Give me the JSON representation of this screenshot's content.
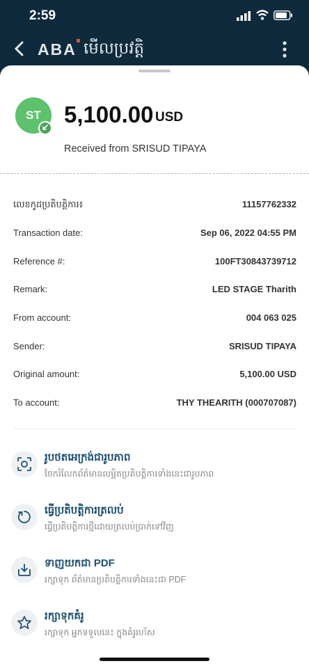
{
  "status_bar": {
    "time": "2:59"
  },
  "app_bar": {
    "brand": "ABA",
    "title": "មើលប្រវត្តិ"
  },
  "transaction": {
    "avatar_initials": "ST",
    "amount": "5,100.00",
    "currency": "USD",
    "received_text": "Received from SRISUD TIPAYA"
  },
  "details": [
    {
      "label": "លេខកូដប្រតិបត្តិការ៖",
      "value": "11157762332"
    },
    {
      "label": "Transaction date:",
      "value": "Sep 06, 2022 04:55 PM"
    },
    {
      "label": "Reference #:",
      "value": "100FT30843739712"
    },
    {
      "label": "Remark:",
      "value": "LED STAGE  Tharith"
    },
    {
      "label": "From account:",
      "value": "004 063 025"
    },
    {
      "label": "Sender:",
      "value": "SRISUD TIPAYA"
    },
    {
      "label": "Original amount:",
      "value": "5,100.00 USD"
    },
    {
      "label": "To account:",
      "value": "THY THEARITH (000707087)"
    }
  ],
  "actions": [
    {
      "icon": "screenshot-icon",
      "title": "រូបថតអេក្រង់ជារូបភាព",
      "subtitle": "ចែករំលែកព័ត៌មានលម្អិតប្រតិបត្តិការទាំងនេះជារូបភាព"
    },
    {
      "icon": "repeat-icon",
      "title": "ធ្វើប្រតិបត្តិការត្រលប់",
      "subtitle": "ធ្វើប្រតិបត្តិការថ្មីដោយត្រលប់ប្រាក់ទៅវិញ"
    },
    {
      "icon": "download-icon",
      "title": "ទាញយកជា PDF",
      "subtitle": "រក្សាទុក ព័ត៌មានប្រតិបត្តិការទាំងនេះជា PDF"
    },
    {
      "icon": "star-icon",
      "title": "រក្សាទុកគំរូ",
      "subtitle": "រក្សាទុក អ្នកទទួលនេះ ក្នុងគំរូរហ័ស"
    }
  ]
}
